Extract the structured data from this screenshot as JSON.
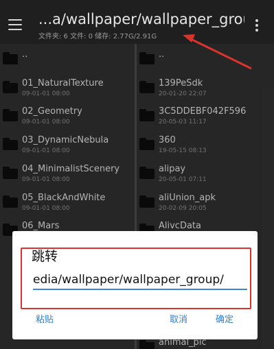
{
  "appbar": {
    "path_title": "...a/wallpaper/wallpaper_group/",
    "path_info": "文件夹: 6  文件: 0  储存: 2.77G/2.91G",
    "menu_icon": "hamburger-menu-icon",
    "more_icon": "more-vertical-icon"
  },
  "left_pane": {
    "items": [
      {
        "name": "..",
        "date": ""
      },
      {
        "name": "01_NaturalTexture",
        "date": "09-01-01 08:00"
      },
      {
        "name": "02_Geometry",
        "date": "09-01-01 08:00"
      },
      {
        "name": "03_DynamicNebula",
        "date": "09-01-01 08:00"
      },
      {
        "name": "04_MinimalistScenery",
        "date": "09-01-01 08:00"
      },
      {
        "name": "05_BlackAndWhite",
        "date": "09-01-01 08:00"
      },
      {
        "name": "06_Mars",
        "date": ""
      }
    ]
  },
  "right_pane": {
    "items": [
      {
        "name": "..",
        "date": ""
      },
      {
        "name": "139PeSdk",
        "date": "20-01-20 22:07"
      },
      {
        "name": "3C5DDEBF042F596",
        "date": "20-05-03 11:17"
      },
      {
        "name": "360",
        "date": "19-05-15 08:13"
      },
      {
        "name": "alipay",
        "date": "20-05-01 07:11"
      },
      {
        "name": "aliUnion_apk",
        "date": "20-02-09 20:05"
      },
      {
        "name": "AlivcData",
        "date": ""
      },
      {
        "name": "animal_pic",
        "date": ""
      }
    ]
  },
  "dialog": {
    "title": "跳转",
    "input_value": "edia/wallpaper/wallpaper_group/",
    "paste_label": "粘贴",
    "cancel_label": "取消",
    "ok_label": "确定"
  },
  "colors": {
    "accent": "#2f7fd6",
    "annotation_red": "#d9342b"
  }
}
